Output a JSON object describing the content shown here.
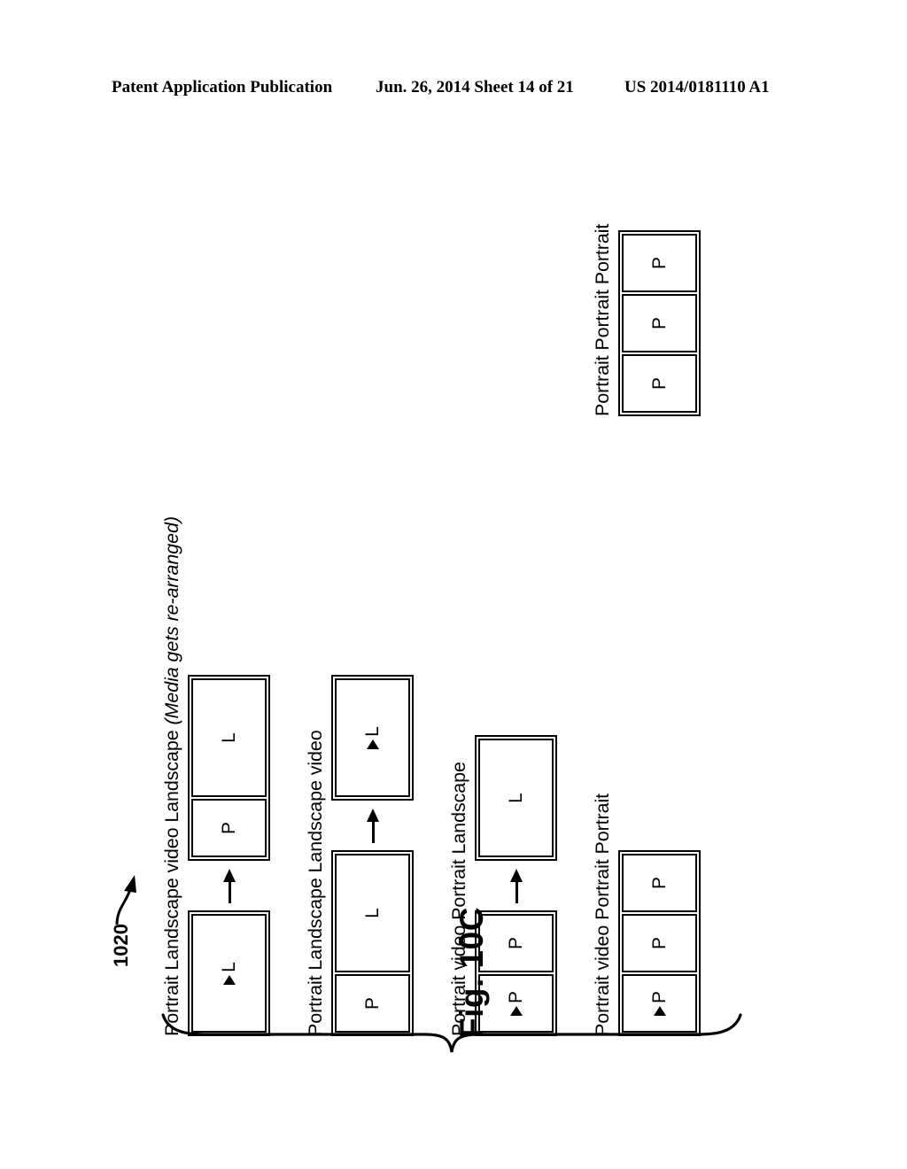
{
  "header": {
    "publication": "Patent Application Publication",
    "date_sheet": "Jun. 26, 2014  Sheet 14 of 21",
    "patent_number": "US 2014/0181110 A1"
  },
  "figure": {
    "caption": "Fig. 10C",
    "reference_numeral": "1020",
    "brace_color": "#000000",
    "rows": [
      {
        "id": "row-1",
        "label_main": "Portrait Landscape video Landscape ",
        "label_italic": "(Media gets re-arranged)",
        "has_arrow": true,
        "before": {
          "cells": [
            {
              "letter": "L",
              "orientation": "landscape",
              "is_video": true
            }
          ]
        },
        "after": {
          "cells": [
            {
              "letter": "P",
              "orientation": "portrait",
              "is_video": false
            },
            {
              "letter": "L",
              "orientation": "landscape",
              "is_video": false
            }
          ]
        }
      },
      {
        "id": "row-2",
        "label_main": "Portrait Landscape Landscape video",
        "label_italic": "",
        "has_arrow": true,
        "before": {
          "cells": [
            {
              "letter": "P",
              "orientation": "portrait",
              "is_video": false
            },
            {
              "letter": "L",
              "orientation": "landscape",
              "is_video": false
            }
          ]
        },
        "after": {
          "cells": [
            {
              "letter": "L",
              "orientation": "landscape",
              "is_video": true
            }
          ]
        }
      },
      {
        "id": "row-3",
        "label_main": "Portrait video Portrait Landscape",
        "label_italic": "",
        "has_arrow": true,
        "before": {
          "cells": [
            {
              "letter": "P",
              "orientation": "portrait",
              "is_video": true
            },
            {
              "letter": "P",
              "orientation": "portrait",
              "is_video": false
            }
          ]
        },
        "after": {
          "cells": [
            {
              "letter": "L",
              "orientation": "landscape",
              "is_video": false
            }
          ]
        }
      },
      {
        "id": "row-4",
        "label_main": "Portrait video Portrait Portrait",
        "label_italic": "",
        "has_arrow": false,
        "before": {
          "cells": [
            {
              "letter": "P",
              "orientation": "portrait",
              "is_video": true
            },
            {
              "letter": "P",
              "orientation": "portrait",
              "is_video": false
            },
            {
              "letter": "P",
              "orientation": "portrait",
              "is_video": false
            }
          ]
        },
        "after": null
      },
      {
        "id": "row-5",
        "label_main": "Portrait Portrait Portrait",
        "label_italic": "",
        "has_arrow": false,
        "before": {
          "cells": [
            {
              "letter": "P",
              "orientation": "portrait",
              "is_video": false
            },
            {
              "letter": "P",
              "orientation": "portrait",
              "is_video": false
            },
            {
              "letter": "P",
              "orientation": "portrait",
              "is_video": false
            }
          ]
        },
        "after": null
      }
    ]
  }
}
